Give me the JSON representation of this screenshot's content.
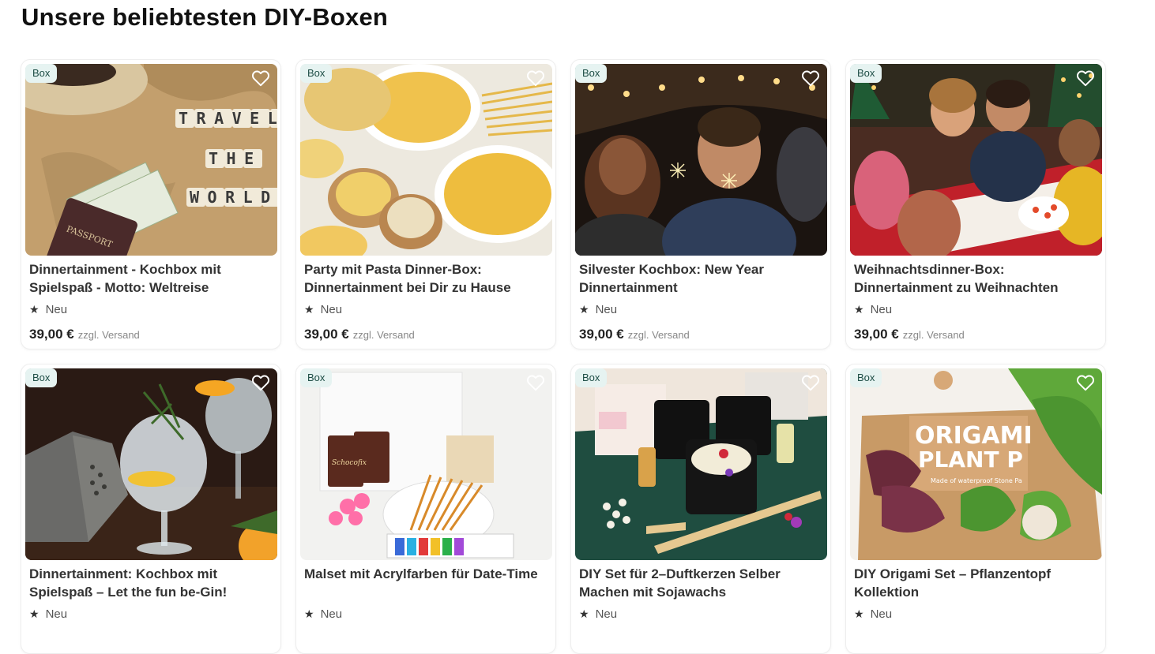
{
  "section": {
    "title": "Unsere beliebtesten DIY-Boxen"
  },
  "colors": {
    "badge_bg": "#e6f3f1",
    "badge_text": "#1d4d45",
    "title_text": "#333333",
    "shipping_text": "#888888"
  },
  "icons": {
    "favorite": "heart-outline-icon",
    "rating": "star-icon"
  },
  "products": [
    {
      "badge": "Box",
      "title": "Dinnertainment - Kochbox mit Spielspaß - Motto: Weltreise",
      "rating_label": "Neu",
      "price": "39,00 €",
      "shipping": "zzgl. Versand",
      "image_word_1": "TRAVEL",
      "image_word_2": "THE",
      "image_word_3": "WORLD",
      "image_word_4": "PASSPORT"
    },
    {
      "badge": "Box",
      "title": "Party mit Pasta Dinner-Box: Dinnertainment bei Dir zu Hause",
      "rating_label": "Neu",
      "price": "39,00 €",
      "shipping": "zzgl. Versand"
    },
    {
      "badge": "Box",
      "title": "Silvester Kochbox: New Year Dinnertainment",
      "rating_label": "Neu",
      "price": "39,00 €",
      "shipping": "zzgl. Versand"
    },
    {
      "badge": "Box",
      "title": "Weihnachtsdinner-Box: Dinnertainment zu Weihnachten",
      "rating_label": "Neu",
      "price": "39,00 €",
      "shipping": "zzgl. Versand"
    },
    {
      "badge": "Box",
      "title": "Dinnertainment: Kochbox mit Spielspaß – Let the fun be-Gin!",
      "rating_label": "Neu"
    },
    {
      "badge": "Box",
      "title": "Malset mit Acrylfarben für Date-Time",
      "rating_label": "Neu",
      "image_word_1": "Schocofix"
    },
    {
      "badge": "Box",
      "title": "DIY Set für 2–Duftkerzen Selber Machen mit Sojawachs",
      "rating_label": "Neu"
    },
    {
      "badge": "Box",
      "title": "DIY Origami Set – Pflanzentopf Kollektion",
      "rating_label": "Neu",
      "image_word_1": "ORIGAMI",
      "image_word_2": "PLANT P",
      "image_word_3": "Made of waterproof Stone Pa"
    }
  ]
}
